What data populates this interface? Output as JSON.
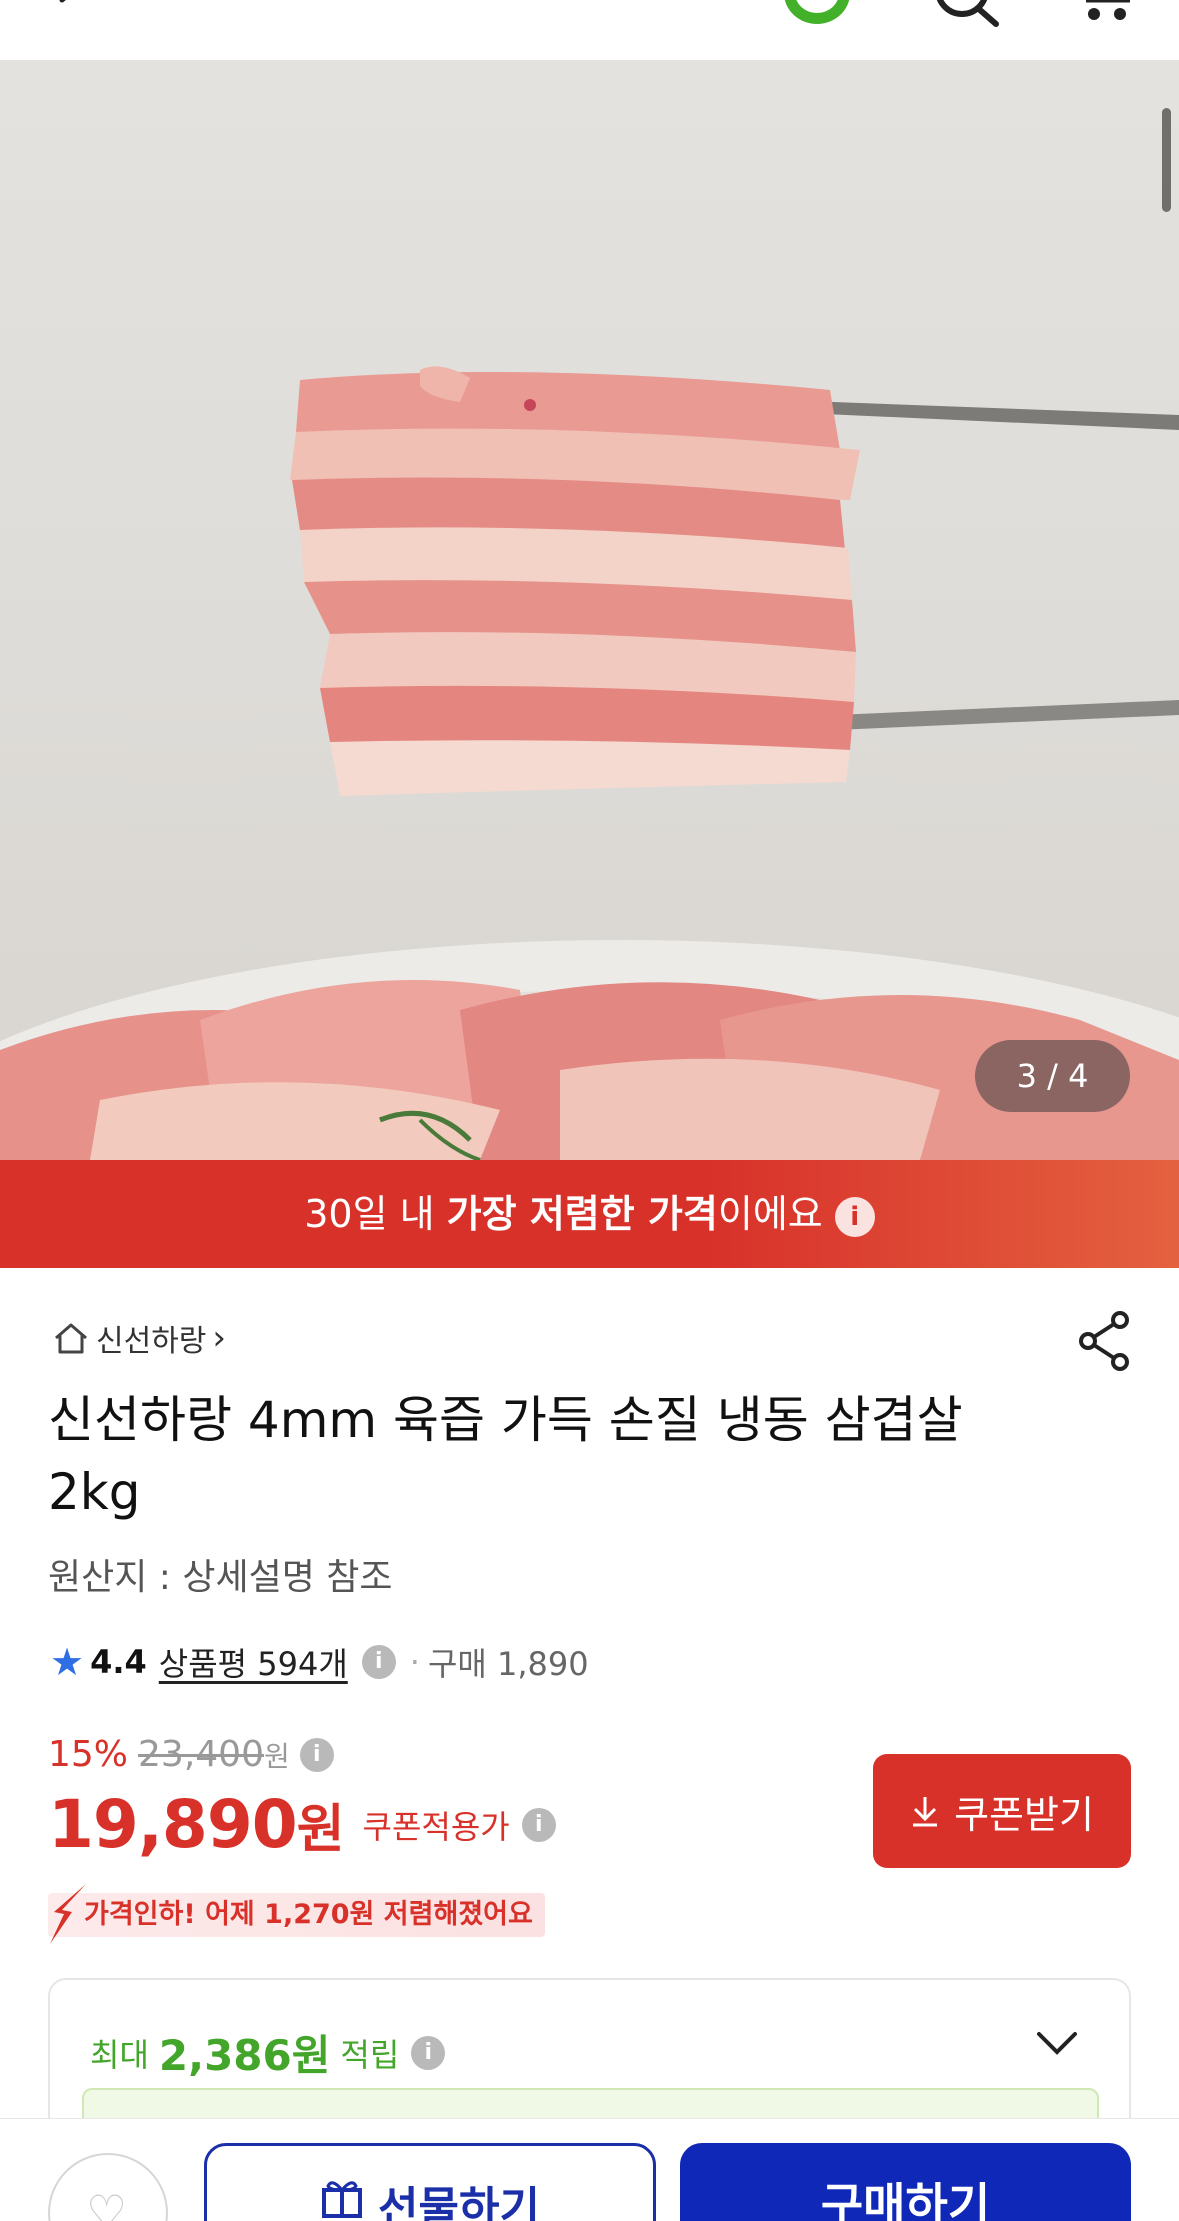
{
  "header": {
    "back_icon": "back-arrow-icon",
    "status_icon": "green-ring-icon",
    "search_icon": "search-icon",
    "cart_icon": "cart-icon"
  },
  "gallery": {
    "counter": "3 / 4",
    "current": 3,
    "total": 4
  },
  "banner": {
    "prefix": "30일 내 ",
    "highlight": "가장 저렴한 가격",
    "suffix": "이에요",
    "info": "i"
  },
  "product": {
    "brand": "신선하랑",
    "brand_arrow": "›",
    "title": "신선하랑 4mm 육즙 가득 손질 냉동 삼겹살 2kg",
    "origin": "원산지 : 상세설명 참조",
    "rating": "4.4",
    "reviews": "상품평 594개",
    "purchases": "구매 1,890",
    "discount_rate": "15%",
    "original_price": "23,400",
    "original_unit": "원",
    "price": "19,890",
    "price_unit": "원",
    "coupon_price_label": "쿠폰적용가",
    "coupon_button": "쿠폰받기",
    "price_drop": "가격인하! 어제 1,270원 저렴해졌어요",
    "reward_prefix": "최대",
    "reward_amount": "2,386원",
    "reward_suffix": "적립"
  },
  "bottom_bar": {
    "wishlist_icon": "heart-icon",
    "gift_label": "선물하기",
    "buy_label": "구매하기"
  },
  "colors": {
    "accent_red": "#d8312a",
    "rating_blue": "#2f6fe4",
    "reward_green": "#43a52a",
    "primary_blue": "#0f28b8"
  }
}
